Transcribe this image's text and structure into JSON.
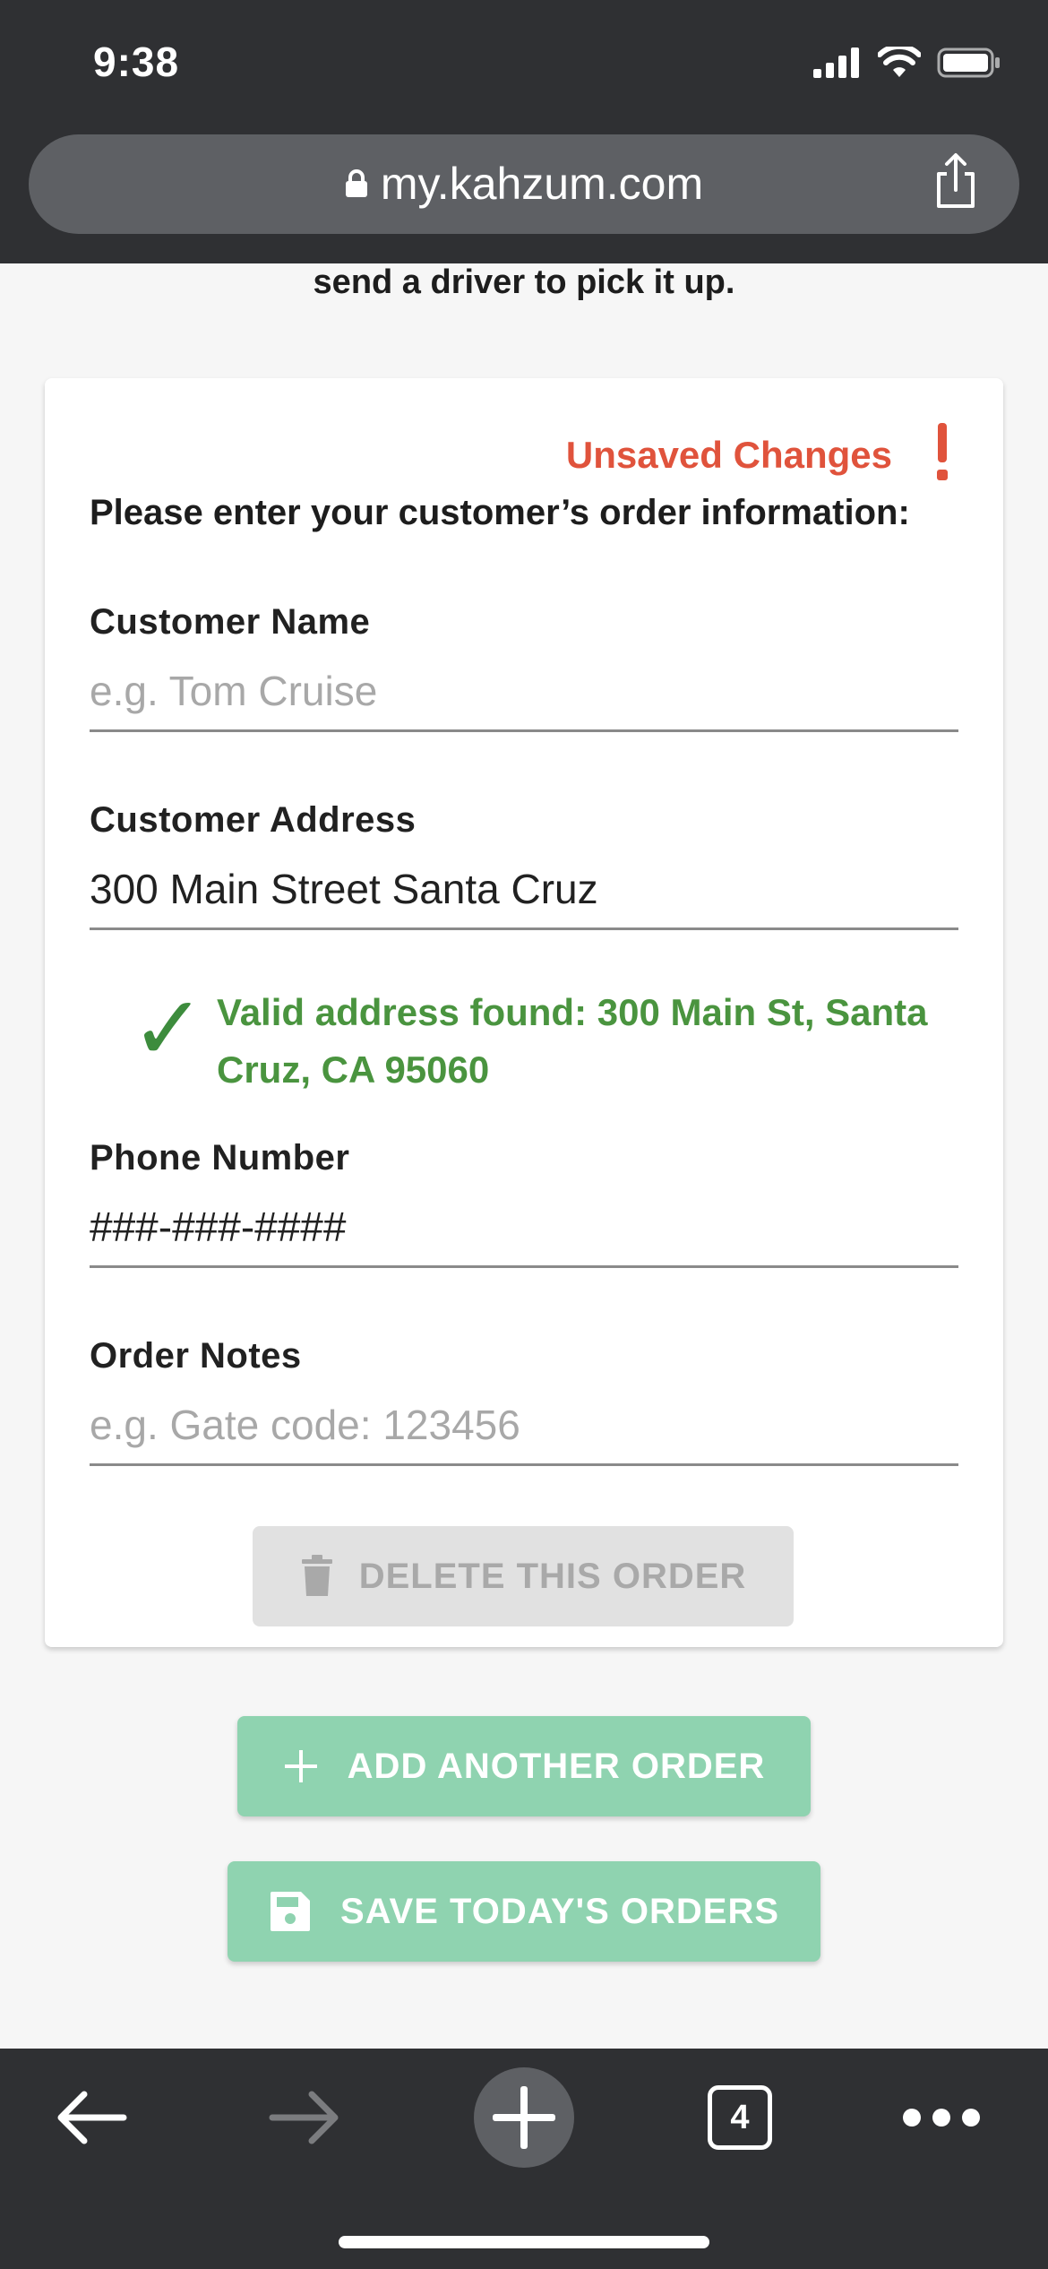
{
  "status_bar": {
    "time": "9:38"
  },
  "browser": {
    "url": "my.kahzum.com",
    "tab_count": "4"
  },
  "intro_text": "send a driver to pick it up.",
  "card": {
    "unsaved_label": "Unsaved Changes",
    "instructions": "Please enter your customer’s order information:",
    "fields": {
      "customer_name": {
        "label": "Customer Name",
        "value": "",
        "placeholder": "e.g. Tom Cruise"
      },
      "customer_address": {
        "label": "Customer Address",
        "value": "300 Main Street Santa Cruz",
        "placeholder": ""
      },
      "phone_number": {
        "label": "Phone Number",
        "value": "###-###-####",
        "placeholder": ""
      },
      "order_notes": {
        "label": "Order Notes",
        "value": "",
        "placeholder": "e.g. Gate code: 123456"
      }
    },
    "address_validation": {
      "icon": "checkmark-icon",
      "text": "Valid address found: 300 Main St, Santa Cruz, CA 95060"
    },
    "delete_button": "DELETE THIS ORDER"
  },
  "actions": {
    "add_order": "ADD ANOTHER ORDER",
    "save_orders": "SAVE TODAY'S ORDERS"
  },
  "colors": {
    "warning": "#e0533c",
    "success": "#4a943f",
    "primary_button": "#8fd3b0",
    "disabled_button": "#e1e1e1",
    "chrome": "#2f3033"
  }
}
